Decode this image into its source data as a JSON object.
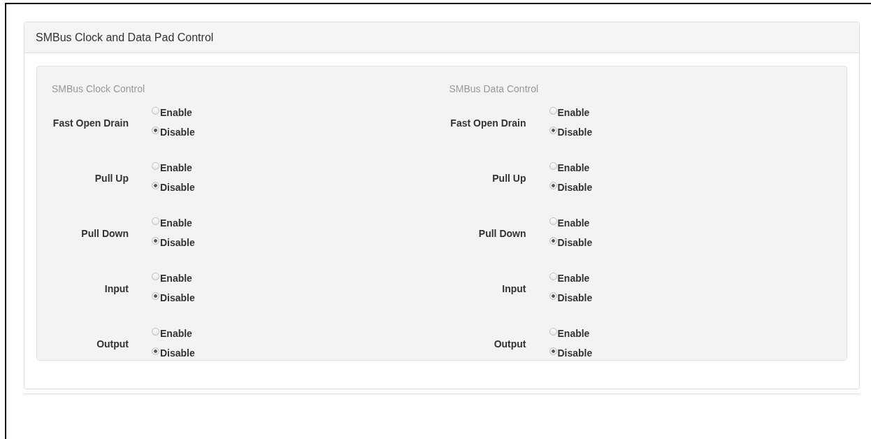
{
  "panel": {
    "title": "SMBus Clock and Data Pad Control"
  },
  "groups": [
    {
      "title": "SMBus Clock Control",
      "settings": [
        {
          "label": "Fast Open Drain",
          "options": [
            {
              "label": "Enable",
              "selected": false
            },
            {
              "label": "Disable",
              "selected": true
            }
          ]
        },
        {
          "label": "Pull Up",
          "options": [
            {
              "label": "Enable",
              "selected": false
            },
            {
              "label": "Disable",
              "selected": true
            }
          ]
        },
        {
          "label": "Pull Down",
          "options": [
            {
              "label": "Enable",
              "selected": false
            },
            {
              "label": "Disable",
              "selected": true
            }
          ]
        },
        {
          "label": "Input",
          "options": [
            {
              "label": "Enable",
              "selected": false
            },
            {
              "label": "Disable",
              "selected": true
            }
          ]
        },
        {
          "label": "Output",
          "options": [
            {
              "label": "Enable",
              "selected": false
            },
            {
              "label": "Disable",
              "selected": true
            }
          ]
        }
      ]
    },
    {
      "title": "SMBus Data Control",
      "settings": [
        {
          "label": "Fast Open Drain",
          "options": [
            {
              "label": "Enable",
              "selected": false
            },
            {
              "label": "Disable",
              "selected": true
            }
          ]
        },
        {
          "label": "Pull Up",
          "options": [
            {
              "label": "Enable",
              "selected": false
            },
            {
              "label": "Disable",
              "selected": true
            }
          ]
        },
        {
          "label": "Pull Down",
          "options": [
            {
              "label": "Enable",
              "selected": false
            },
            {
              "label": "Disable",
              "selected": true
            }
          ]
        },
        {
          "label": "Input",
          "options": [
            {
              "label": "Enable",
              "selected": false
            },
            {
              "label": "Disable",
              "selected": true
            }
          ]
        },
        {
          "label": "Output",
          "options": [
            {
              "label": "Enable",
              "selected": false
            },
            {
              "label": "Disable",
              "selected": true
            }
          ]
        }
      ]
    }
  ]
}
